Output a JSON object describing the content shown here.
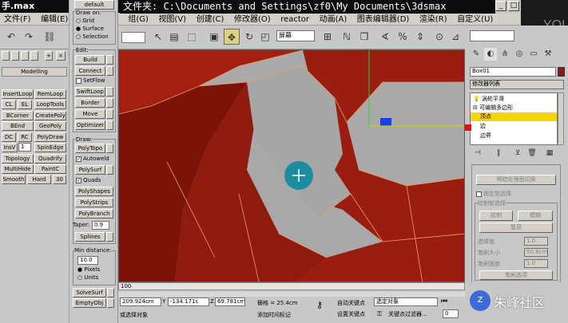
{
  "window": {
    "title": "手.max",
    "file_path": "文件夹: C:\\Documents and Settings\\zf0\\My Documents\\3dsmax"
  },
  "menu": [
    "文件(F)",
    "编辑(E)",
    "",
    "组(G)",
    "视图(V)",
    "创建(C)",
    "修改器(O)",
    "reactor",
    "动画(A)",
    "图表编辑器(D)",
    "渲染(R)",
    "自定义(U)"
  ],
  "toolbar": {
    "view_dropdown": "屏幕"
  },
  "left_panel": {
    "header": "Modelling",
    "rows": [
      [
        "InsertLoop",
        "RemLoop"
      ],
      [
        "CL",
        "EL",
        "LoopTools"
      ],
      [
        "BCorner",
        "CreatePoly"
      ],
      [
        "BEnd",
        "GeoPoly"
      ],
      [
        "DC",
        "RC",
        "PolyDraw"
      ],
      [
        "InsV",
        "1",
        "SpinEdge"
      ],
      [
        "Topology",
        "Quadrify"
      ],
      [
        "MultiHide",
        "PaintC"
      ],
      [
        "Smooth",
        "Hard",
        "30"
      ]
    ]
  },
  "polydraw_panel": {
    "default_label": "default",
    "draw_on_label": "Draw on:",
    "draw_on_options": [
      "Grid",
      "Surface",
      "Selection"
    ],
    "edit_label": "Edit:",
    "edit_buttons": [
      "Build",
      "Connect",
      "SetFlow",
      "SwiftLoop",
      "Border",
      "Move",
      "Optimizer"
    ],
    "draw_label": "Draw:",
    "draw_buttons": [
      "PolyTopo",
      "Autoweld",
      "PolySurf",
      "Quads",
      "PolyShapes",
      "PolyStrips",
      "PolyBranch"
    ],
    "taper_label": "Taper:",
    "taper_value": "0.9",
    "splines_label": "Splines",
    "min_distance_label": "Min distance:",
    "min_distance_value": "10.0",
    "units": [
      "Pixels",
      "Units"
    ],
    "bottom_buttons": [
      "SolveSurf",
      "EmptyObj"
    ]
  },
  "right_panel": {
    "object_name": "Box01",
    "modifier_list": "修改器列表",
    "stack": [
      "涡轮平滑",
      "可编辑多边形",
      "顶点",
      "边",
      "边界"
    ],
    "rollout_title": "明暗处理面切换",
    "lock_soft_sel": "锁定软选择",
    "paint_soft_sel": "绘制软选择",
    "paint_buttons": [
      "绘制",
      "模糊"
    ],
    "revert_label": "复原",
    "brush_rows": [
      {
        "label": "选择值",
        "value": "1.0"
      },
      {
        "label": "笔刷大小",
        "value": "50.8cm"
      },
      {
        "label": "笔刷强度",
        "value": "1.0"
      }
    ],
    "brush_options": "笔刷选项"
  },
  "status": {
    "timeline_end": "100",
    "x_value": "209.924cm",
    "y_value": "-134.171c",
    "z_value": "69.781cm",
    "grid_text": "栅格 = 25.4cm",
    "auto_key": "自动关键点",
    "selected_object": "选定对象",
    "set_key": "设置关键点",
    "key_filters": "关键点过滤器...",
    "prompt_left": "或选择对象",
    "prompt_right": "添加时间标记",
    "frame_value": "0"
  },
  "watermark": "朱峰社区"
}
